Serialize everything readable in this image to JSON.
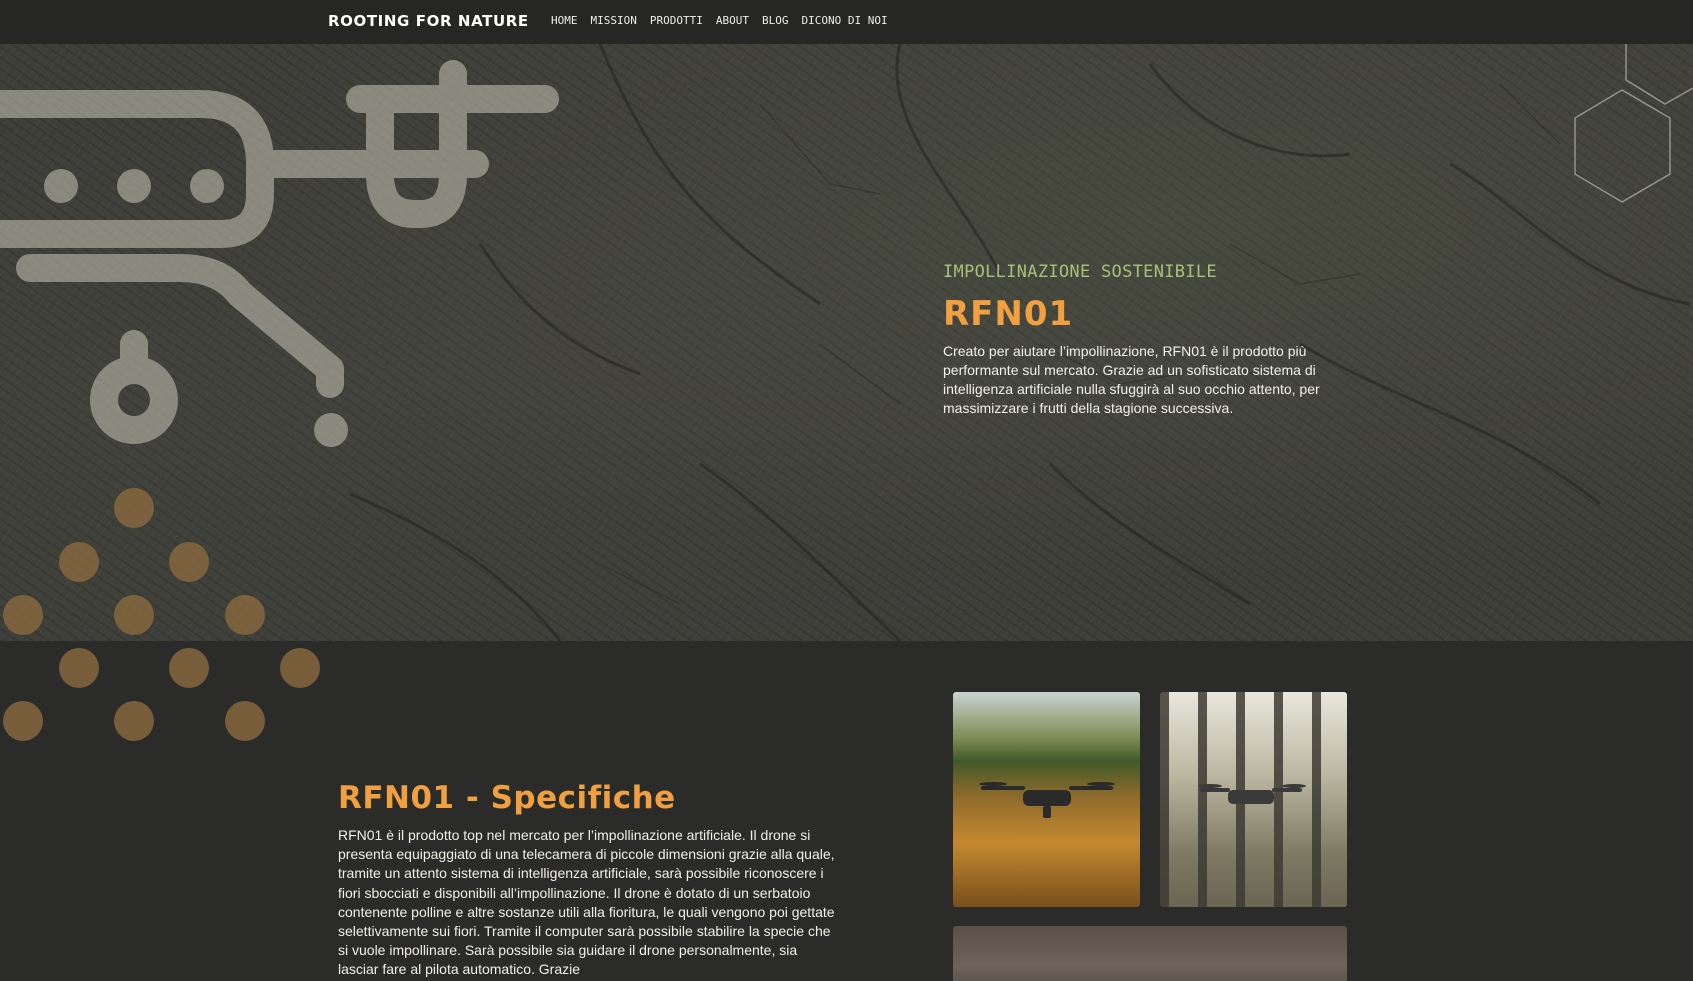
{
  "brand": {
    "logo": "ROOTING FOR NATURE"
  },
  "nav": {
    "items": [
      {
        "label": "HOME"
      },
      {
        "label": "MISSION"
      },
      {
        "label": "PRODOTTI"
      },
      {
        "label": "ABOUT"
      },
      {
        "label": "BLOG"
      },
      {
        "label": "DICONO DI NOI"
      }
    ]
  },
  "hero": {
    "eyebrow": "IMPOLLINAZIONE SOSTENIBILE",
    "title": "RFN01",
    "description": "Creato per aiutare l’impollinazione, RFN01 è il prodotto più performante sul mercato. Grazie ad un sofisticato sistema di intelligenza artificiale nulla sfuggirà al suo occhio attento, per massimizzare i frutti della stagione successiva."
  },
  "specs": {
    "title": "RFN01 - Specifiche",
    "description": "RFN01 è il prodotto top nel mercato per l’impollinazione artificiale. Il drone si presenta equipaggiato di una telecamera di piccole dimensioni grazie alla quale, tramite un attento sistema di intelligenza artificiale, sarà possibile riconoscere i fiori sbocciati e disponibili all’impollinazione. Il drone è dotato di un serbatoio contenente polline e altre sostanze utili alla fioritura, le quali vengono poi gettate selettivamente sui fiori. Tramite il computer sarà possibile stabilire la specie che si vuole impollinare. Sarà possibile sia guidare il drone personalmente, sia lasciar fare al pilota automatico. Grazie"
  },
  "icons": {
    "drone": "drone-icon",
    "pollen": "pollen-dots-icon",
    "hexagon": "hexagon-outline-icon"
  },
  "colors": {
    "background": "#2b2c29",
    "accent_orange": "#f0a040",
    "eyebrow_green": "#a9c07a",
    "drone_gray": "#c9c6b6",
    "dot_brown": "#8a6a3e"
  }
}
